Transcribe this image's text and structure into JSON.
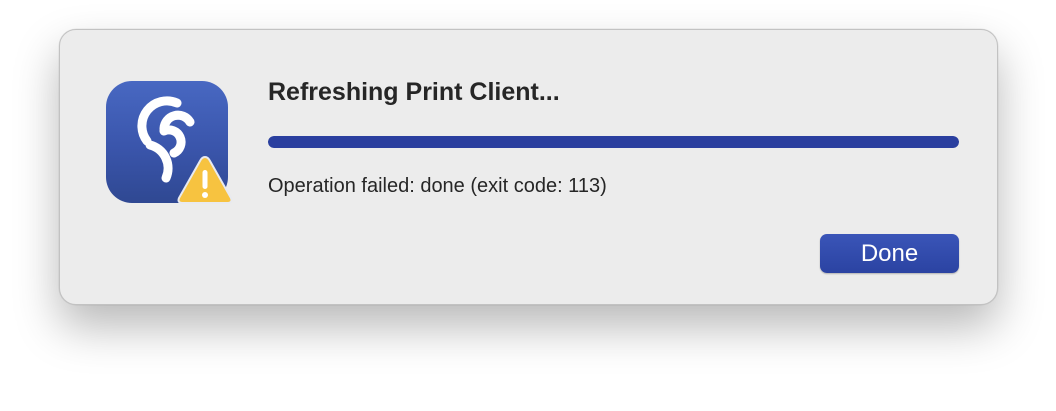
{
  "dialog": {
    "title": "Refreshing Print Client...",
    "status": "Operation failed: done (exit code: 113)",
    "progress_percent": 100,
    "done_label": "Done"
  },
  "icons": {
    "app": "print-client-app-icon",
    "badge": "warning-icon"
  },
  "colors": {
    "accent": "#2a3f9f",
    "warning": "#f7c340",
    "icon_background": "#3d58b0"
  }
}
